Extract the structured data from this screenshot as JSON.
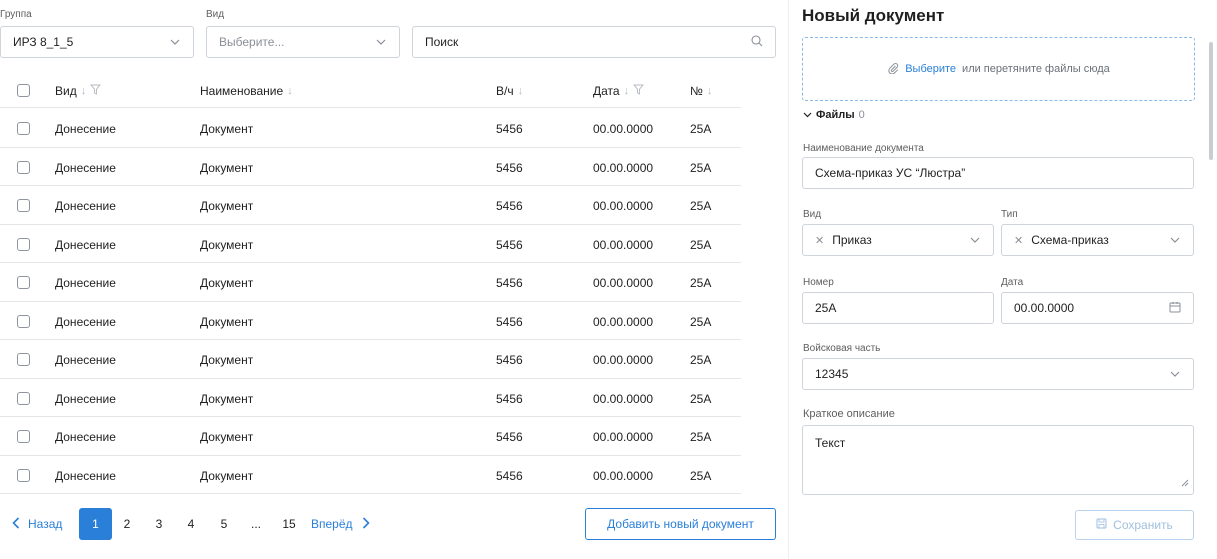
{
  "filters": {
    "group_label": "Группа",
    "group_value": "ИРЗ 8_1_5",
    "kind_label": "Вид",
    "kind_placeholder": "Выберите...",
    "search_placeholder": "Поиск"
  },
  "table": {
    "columns": [
      "Вид",
      "Наименование",
      "В/ч",
      "Дата",
      "№"
    ],
    "rows": [
      [
        "Донесение",
        "Документ",
        "5456",
        "00.00.0000",
        "25А"
      ],
      [
        "Донесение",
        "Документ",
        "5456",
        "00.00.0000",
        "25А"
      ],
      [
        "Донесение",
        "Документ",
        "5456",
        "00.00.0000",
        "25А"
      ],
      [
        "Донесение",
        "Документ",
        "5456",
        "00.00.0000",
        "25А"
      ],
      [
        "Донесение",
        "Документ",
        "5456",
        "00.00.0000",
        "25А"
      ],
      [
        "Донесение",
        "Документ",
        "5456",
        "00.00.0000",
        "25А"
      ],
      [
        "Донесение",
        "Документ",
        "5456",
        "00.00.0000",
        "25А"
      ],
      [
        "Донесение",
        "Документ",
        "5456",
        "00.00.0000",
        "25А"
      ],
      [
        "Донесение",
        "Документ",
        "5456",
        "00.00.0000",
        "25А"
      ],
      [
        "Донесение",
        "Документ",
        "5456",
        "00.00.0000",
        "25А"
      ]
    ]
  },
  "pagination": {
    "prev": "Назад",
    "next": "Вперёд",
    "pages": [
      "1",
      "2",
      "3",
      "4",
      "5",
      "...",
      "15"
    ],
    "current": "1"
  },
  "add_button": "Добавить новый документ",
  "form": {
    "title": "Новый документ",
    "dropzone_link": "Выберите",
    "dropzone_text": "или перетяните файлы сюда",
    "files_label": "Файлы",
    "files_count": "0",
    "name_label": "Наименование документа",
    "name_value": "Схема-приказ  УС “Люстра”",
    "kind_label": "Вид",
    "kind_value": "Приказ",
    "type_label": "Тип",
    "type_value": "Схема-приказ",
    "number_label": "Номер",
    "number_value": "25А",
    "date_label": "Дата",
    "date_value": "00.00.0000",
    "unit_label": "Войсковая часть",
    "unit_value": "12345",
    "desc_label": "Краткое описание",
    "desc_value": "Текст",
    "save": "Сохранить"
  },
  "colors": {
    "accent": "#2a7fd8",
    "border": "#cfd3da",
    "row_divider": "#e4e6ea"
  }
}
